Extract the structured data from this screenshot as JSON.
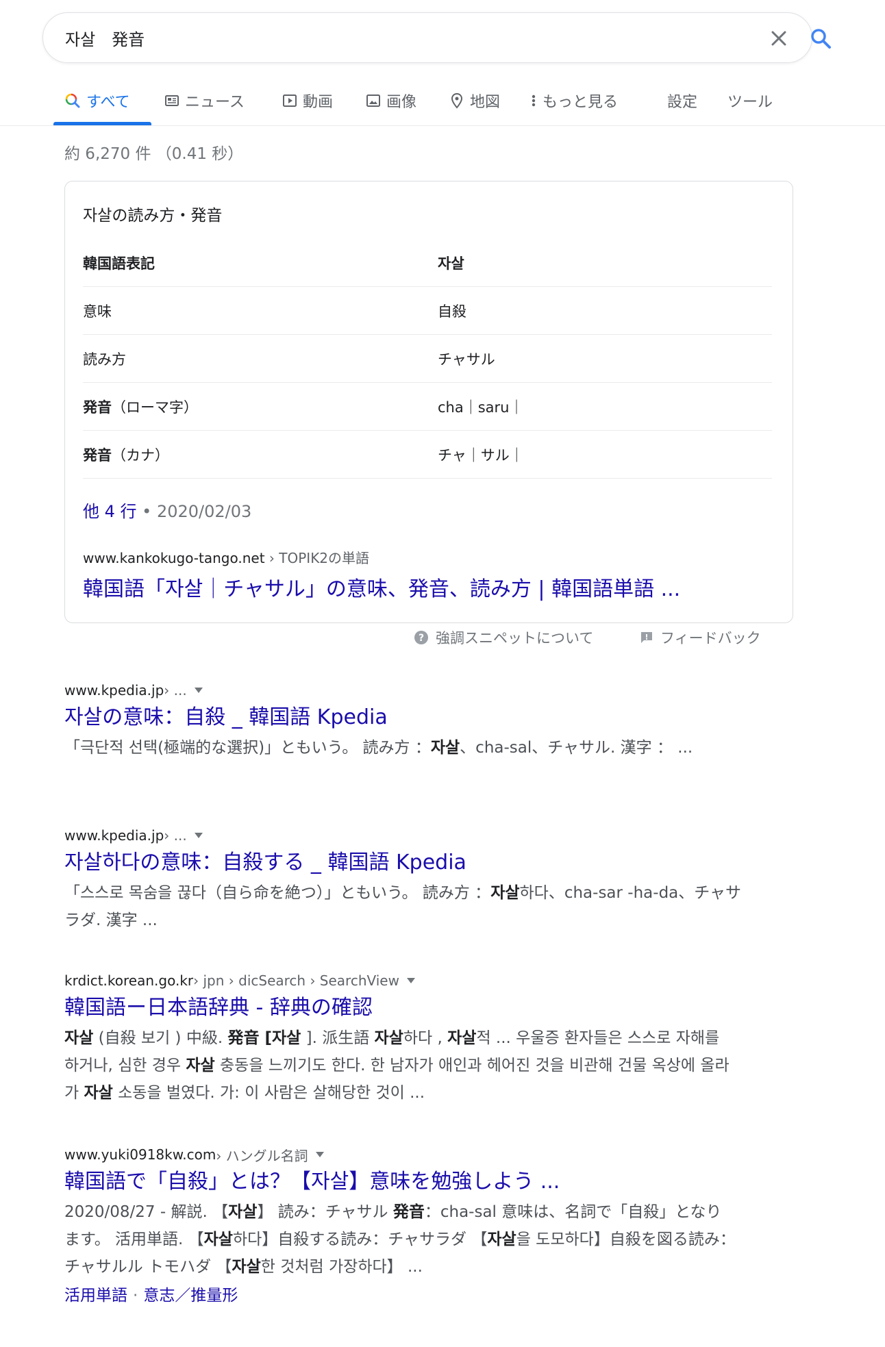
{
  "search": {
    "query": "자살　発音"
  },
  "tabs": [
    {
      "label": "すべて",
      "icon": "search-multicolor-icon",
      "active": true
    },
    {
      "label": "ニュース",
      "icon": "newspaper-icon"
    },
    {
      "label": "動画",
      "icon": "play-icon"
    },
    {
      "label": "画像",
      "icon": "image-icon"
    },
    {
      "label": "地図",
      "icon": "map-pin-icon"
    },
    {
      "label": "もっと見る",
      "icon": "more-vert-icon"
    },
    {
      "label": "設定"
    },
    {
      "label": "ツール"
    }
  ],
  "stats": "約 6,270 件 （0.41 秒）",
  "snippet": {
    "title": "자살の読み方・発音",
    "rows": [
      {
        "c1": "韓国語表記",
        "c2": "자살"
      },
      {
        "c1": "意味",
        "c2": "自殺"
      },
      {
        "c1": "読み方",
        "c2": "チャサル"
      },
      {
        "c1_bold": "発音",
        "c1_rest": "（ローマ字）",
        "c2": "cha｜saru｜"
      },
      {
        "c1_bold": "発音",
        "c1_rest": "（カナ）",
        "c2": "チャ｜サル｜"
      }
    ],
    "more_rows": "他 4 行",
    "date": " • 2020/02/03",
    "url": "www.kankokugo-tango.net",
    "breadcrumb": " › TOPIK2の単語",
    "link": "韓国語「자살｜チャサル」の意味、発音、読み方 | 韓国語単語 ..."
  },
  "snippet_footer": {
    "about": "強調スニペットについて",
    "feedback": "フィードバック"
  },
  "results": [
    {
      "url": "www.kpedia.jp",
      "crumb": " › ...",
      "title": "자살の意味：自殺 _ 韓国語 Kpedia",
      "snippet_parts": [
        {
          "t": "「극단적 선택(極端的な選択)」ともいう。 読み方 ："
        },
        {
          "t": "자살",
          "b": true
        },
        {
          "t": "、cha-sal、チャサル. 漢字 ： ..."
        }
      ]
    },
    {
      "url": "www.kpedia.jp",
      "crumb": " › ...",
      "title": "자살하다の意味：自殺する _ 韓国語 Kpedia",
      "snippet_parts": [
        {
          "t": "「스스로 목숨을 끊다（自ら命を絶つ）」ともいう。 読み方 ："
        },
        {
          "t": "자살",
          "b": true
        },
        {
          "t": "하다、cha-sar -ha-da、チャサラダ. 漢字 ..."
        }
      ]
    },
    {
      "url": "krdict.korean.go.kr",
      "crumb": " › jpn › dicSearch › SearchView",
      "title": "韓国語ー日本語辞典 - 辞典の確認",
      "snippet_parts": [
        {
          "t": "자살",
          "b": true
        },
        {
          "t": " (自殺 보기 ) 中級. "
        },
        {
          "t": "発音",
          "b": true
        },
        {
          "t": " [자살",
          "b": true
        },
        {
          "t": " ]. 派生語 "
        },
        {
          "t": "자살",
          "b": true
        },
        {
          "t": "하다 , "
        },
        {
          "t": "자살",
          "b": true
        },
        {
          "t": "적 ... 우울증 환자들은 스스로 자해를 하거나, 심한 경우 "
        },
        {
          "t": "자살",
          "b": true
        },
        {
          "t": " 충동을 느끼기도 한다. 한 남자가 애인과 헤어진 것을 비관해 건물 옥상에 올라가 "
        },
        {
          "t": "자살",
          "b": true
        },
        {
          "t": " 소동을 벌였다. 가: 이 사람은 살해당한 것이 ..."
        }
      ]
    },
    {
      "url": "www.yuki0918kw.com",
      "crumb": " › ハングル名詞",
      "title": "韓国語で「自殺」とは？【자살】意味を勉強しよう ...",
      "snippet_parts": [
        {
          "t": "2020/08/27 - 解説. 【"
        },
        {
          "t": "자살",
          "b": true
        },
        {
          "t": "】 読み：チャサル "
        },
        {
          "t": "発音",
          "b": true
        },
        {
          "t": "：cha-sal 意味は、名詞で「自殺」となります。 活用単語. 【"
        },
        {
          "t": "자살",
          "b": true
        },
        {
          "t": "하다】自殺する読み：チャサラダ 【"
        },
        {
          "t": "자살",
          "b": true
        },
        {
          "t": "을 도모하다】自殺を図る読み：チャサルル トモハダ 【"
        },
        {
          "t": "자살",
          "b": true
        },
        {
          "t": "한 것처럼 가장하다】 ..."
        }
      ],
      "sublinks": [
        "活用単語",
        "意志／推量形"
      ]
    }
  ],
  "colors": {
    "accent": "#1a73e8",
    "link": "#1a0dab",
    "muted": "#70757a"
  }
}
